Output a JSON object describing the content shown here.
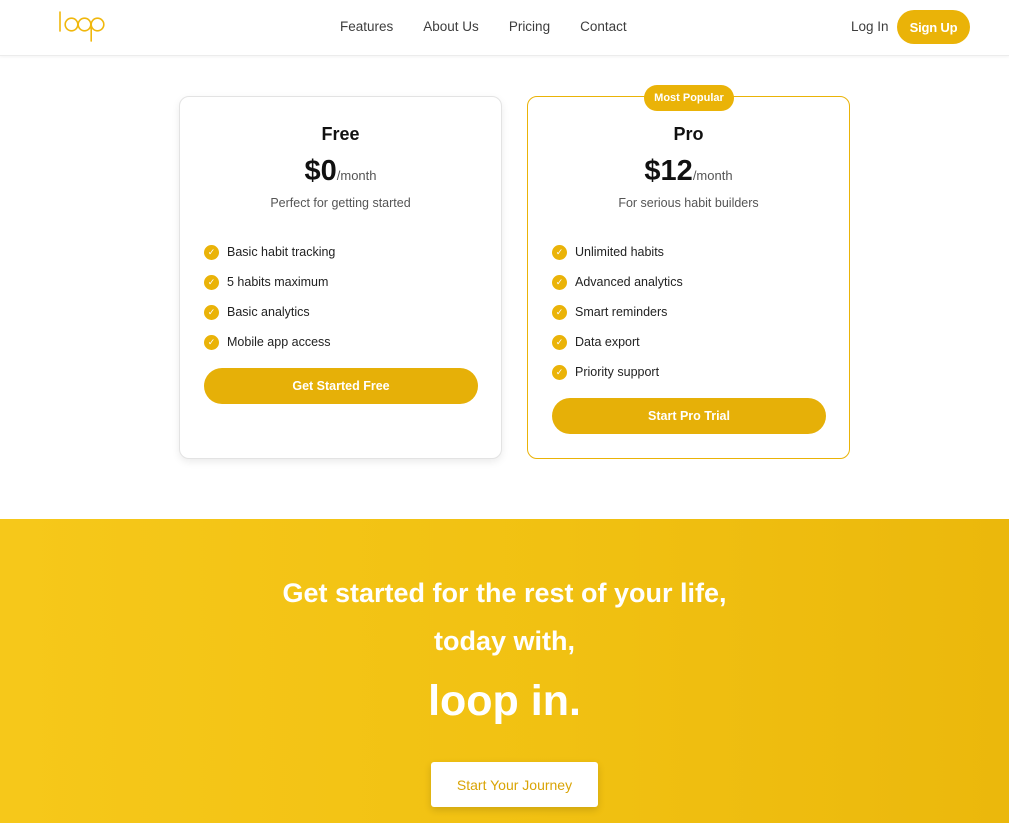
{
  "brand": {
    "logo_text": "loop",
    "accent_color": "#eab308"
  },
  "nav": {
    "items": [
      "Features",
      "About Us",
      "Pricing",
      "Contact"
    ],
    "login": "Log In",
    "signup": "Sign Up"
  },
  "plans": {
    "free": {
      "name": "Free",
      "price": "$0",
      "period": "/month",
      "subtitle": "Perfect for getting started",
      "features": [
        "Basic habit tracking",
        "5 habits maximum",
        "Basic analytics",
        "Mobile app access"
      ],
      "button": "Get Started Free"
    },
    "pro": {
      "badge": "Most Popular",
      "name": "Pro",
      "price": "$12",
      "period": "/month",
      "subtitle": "For serious habit builders",
      "features": [
        "Unlimited habits",
        "Advanced analytics",
        "Smart reminders",
        "Data export",
        "Priority support"
      ],
      "button": "Start Pro Trial"
    }
  },
  "cta": {
    "line1": "Get started for the rest of your life,",
    "line2": "today with,",
    "brand": "loop in.",
    "button": "Start Your Journey"
  },
  "icons": {
    "check": "check-icon",
    "logo": "loop-logo-icon"
  }
}
